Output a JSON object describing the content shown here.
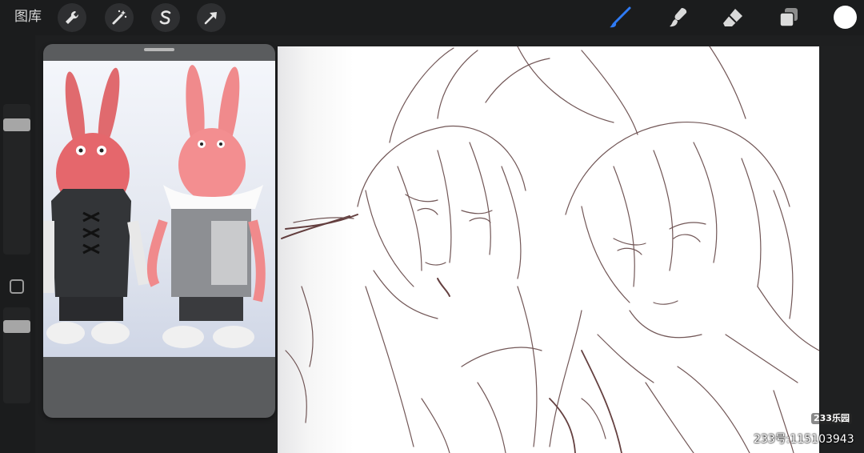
{
  "toolbar": {
    "gallery_label": "图库",
    "left_tools": [
      "wrench-icon",
      "magic-wand-icon",
      "selection-s-icon",
      "transform-arrow-icon"
    ],
    "right_tools": [
      "brush-icon",
      "smudge-icon",
      "eraser-icon",
      "layers-icon"
    ],
    "active_tool": "brush-icon",
    "current_color": "#ffffff",
    "accent_color": "#2f7bf5"
  },
  "sidebar": {
    "controls": [
      "brush-size-slider",
      "modify-button",
      "opacity-slider"
    ]
  },
  "reference": {
    "content": "reference-image"
  },
  "watermark": {
    "badge": "233乐园",
    "text": "233号:115103943"
  }
}
